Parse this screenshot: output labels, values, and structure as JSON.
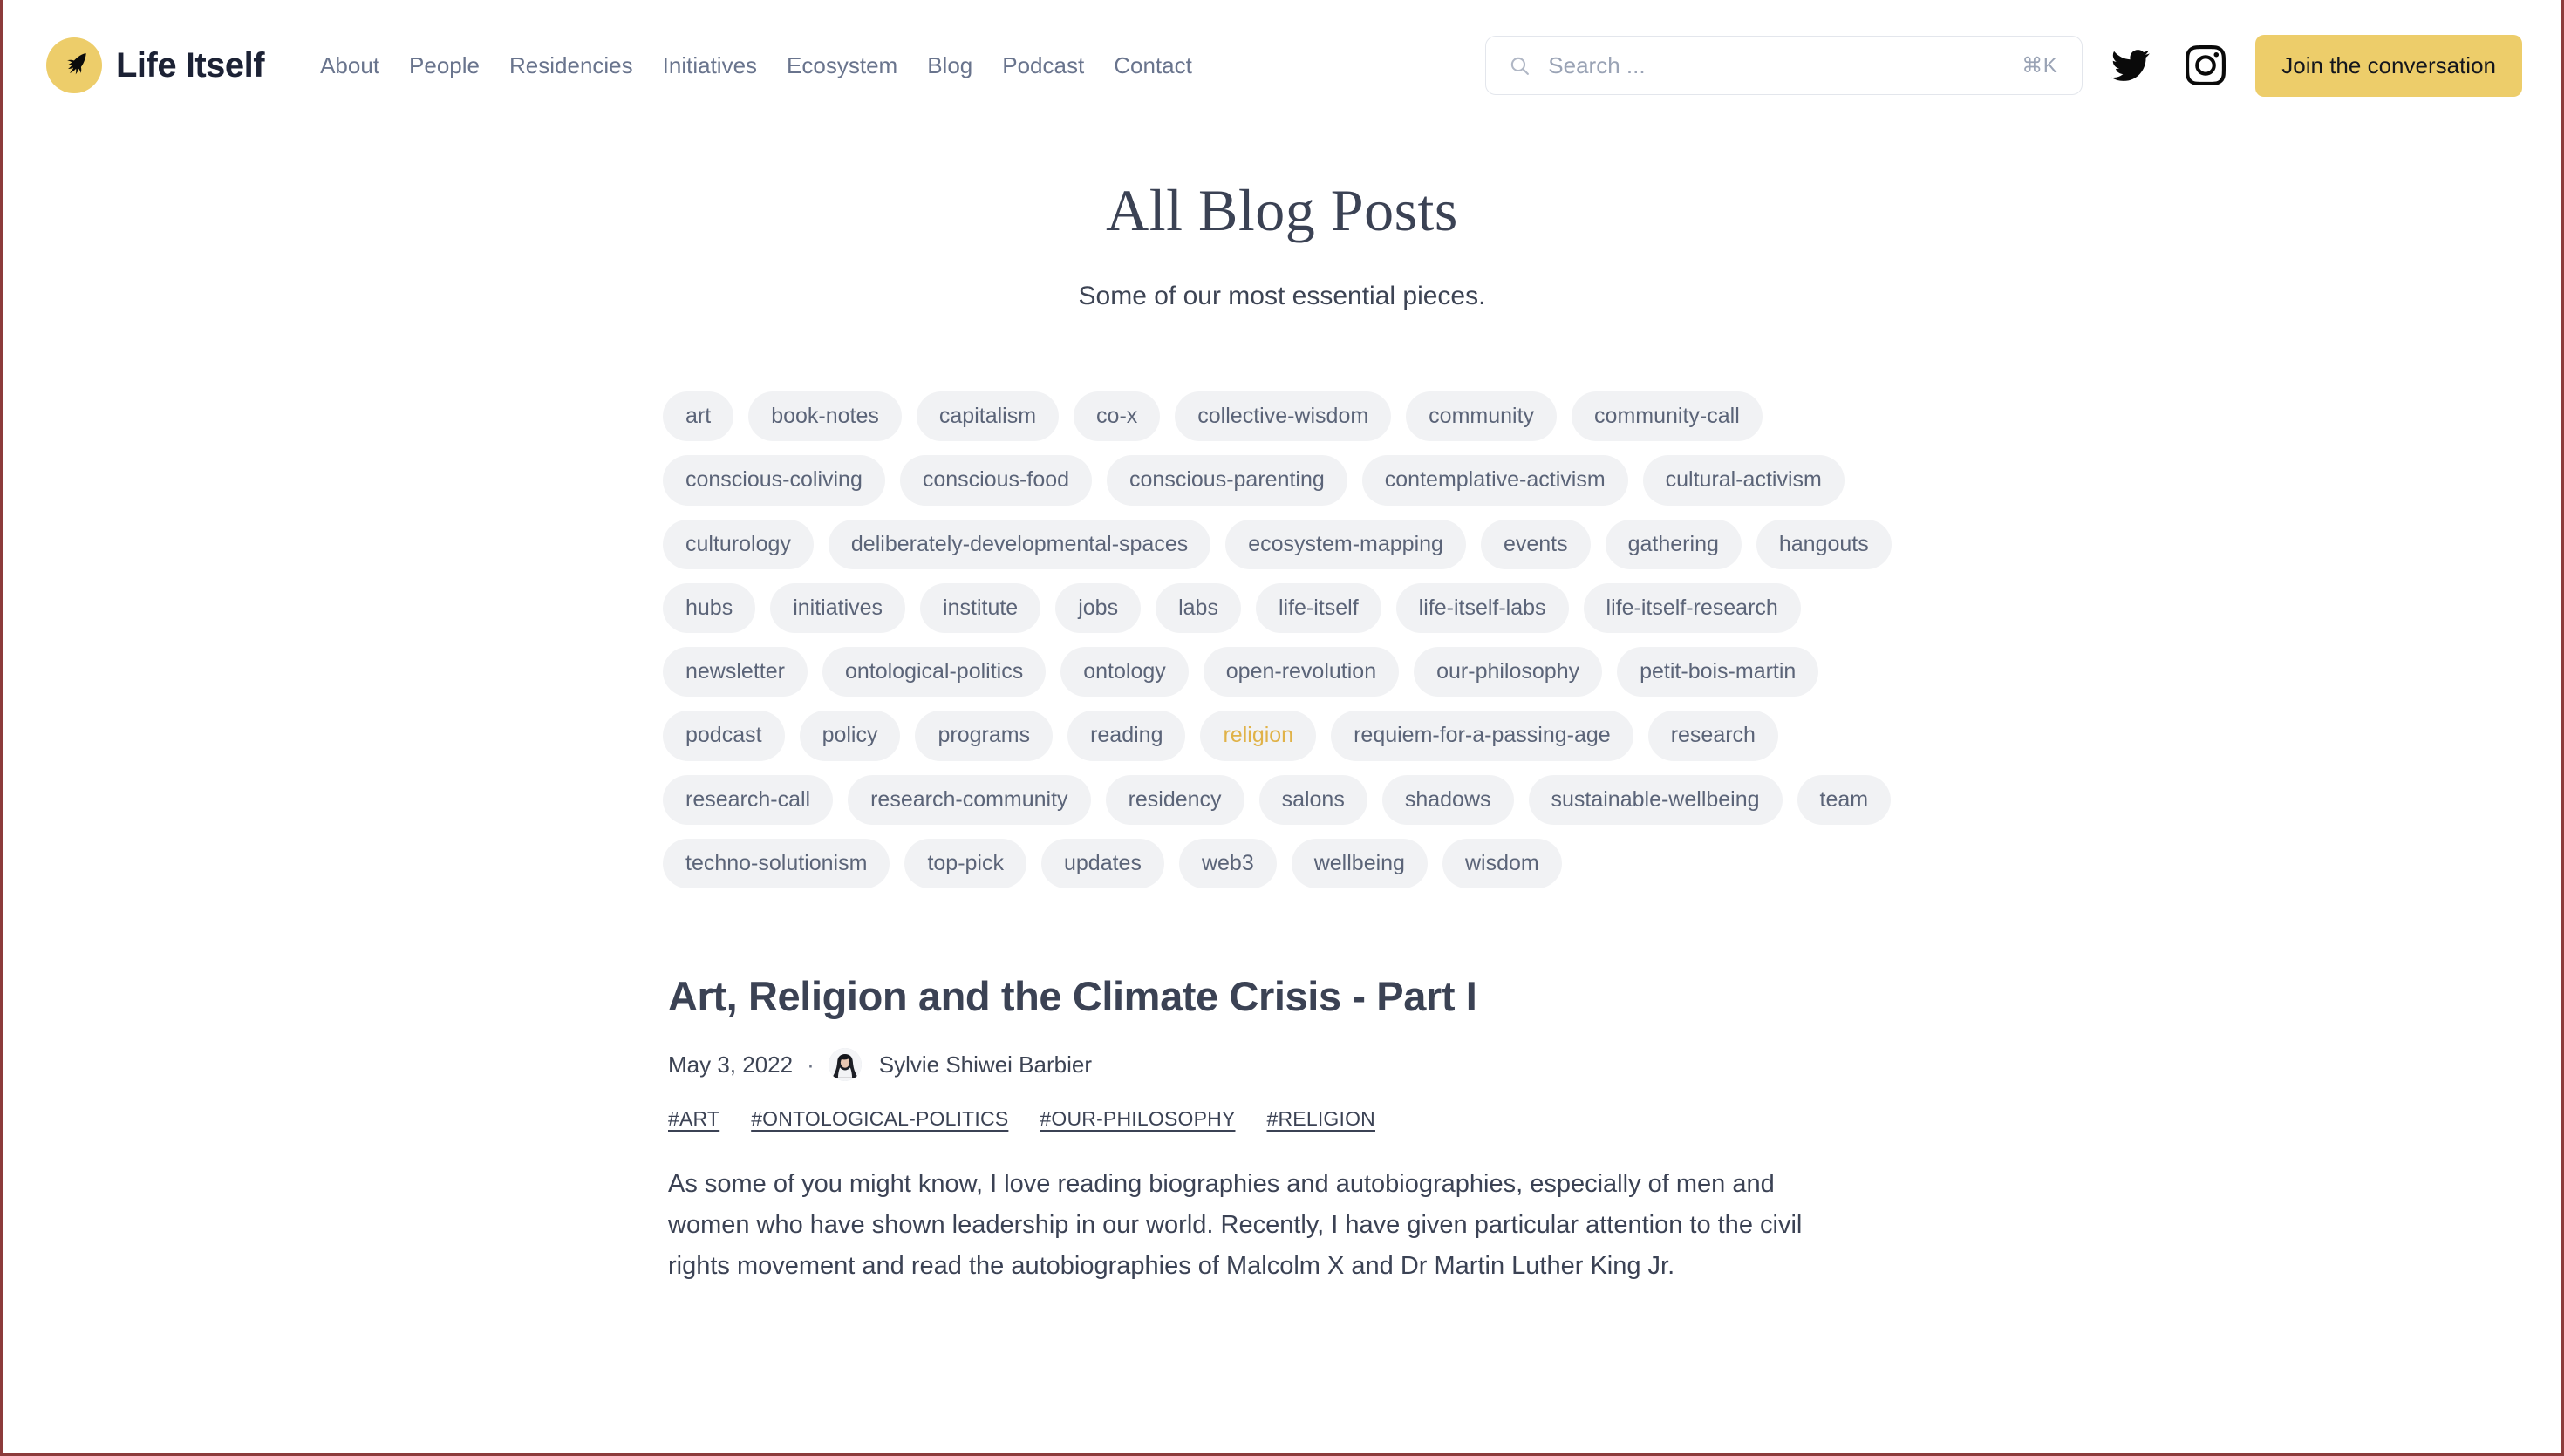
{
  "header": {
    "brand": {
      "name": "Life Itself",
      "logo_icon": "swallow-bird-icon",
      "logo_bg": "#edcd6a"
    },
    "nav": [
      {
        "label": "About"
      },
      {
        "label": "People"
      },
      {
        "label": "Residencies"
      },
      {
        "label": "Initiatives"
      },
      {
        "label": "Ecosystem"
      },
      {
        "label": "Blog"
      },
      {
        "label": "Podcast"
      },
      {
        "label": "Contact"
      }
    ],
    "search": {
      "icon": "search-icon",
      "placeholder": "Search ...",
      "value": "",
      "shortcut": "⌘K"
    },
    "social": [
      {
        "name": "twitter-icon",
        "label": "Twitter"
      },
      {
        "name": "instagram-icon",
        "label": "Instagram"
      }
    ],
    "cta": {
      "label": "Join the conversation",
      "color": "#edcd6a"
    }
  },
  "page": {
    "title": "All Blog Posts",
    "subtitle": "Some of our most essential pieces."
  },
  "tags": {
    "active": "religion",
    "active_color": "#e0b248",
    "items": [
      "art",
      "book-notes",
      "capitalism",
      "co-x",
      "collective-wisdom",
      "community",
      "community-call",
      "conscious-coliving",
      "conscious-food",
      "conscious-parenting",
      "contemplative-activism",
      "cultural-activism",
      "culturology",
      "deliberately-developmental-spaces",
      "ecosystem-mapping",
      "events",
      "gathering",
      "hangouts",
      "hubs",
      "initiatives",
      "institute",
      "jobs",
      "labs",
      "life-itself",
      "life-itself-labs",
      "life-itself-research",
      "newsletter",
      "ontological-politics",
      "ontology",
      "open-revolution",
      "our-philosophy",
      "petit-bois-martin",
      "podcast",
      "policy",
      "programs",
      "reading",
      "religion",
      "requiem-for-a-passing-age",
      "research",
      "research-call",
      "research-community",
      "residency",
      "salons",
      "shadows",
      "sustainable-wellbeing",
      "team",
      "techno-solutionism",
      "top-pick",
      "updates",
      "web3",
      "wellbeing",
      "wisdom"
    ]
  },
  "posts": [
    {
      "title": "Art, Religion and the Climate Crisis - Part I",
      "date": "May 3, 2022",
      "separator": "·",
      "author": "Sylvie Shiwei Barbier",
      "tags": [
        "#ART",
        "#ONTOLOGICAL-POLITICS",
        "#OUR-PHILOSOPHY",
        "#RELIGION"
      ],
      "excerpt": "As some of you might know, I love reading  biographies and  autobiographies, especially of men and women who have shown leadership in our world. Recently, I have given particular attention to the civil rights movement and read the autobiographies of Malcolm X and Dr Martin Luther King Jr."
    }
  ]
}
